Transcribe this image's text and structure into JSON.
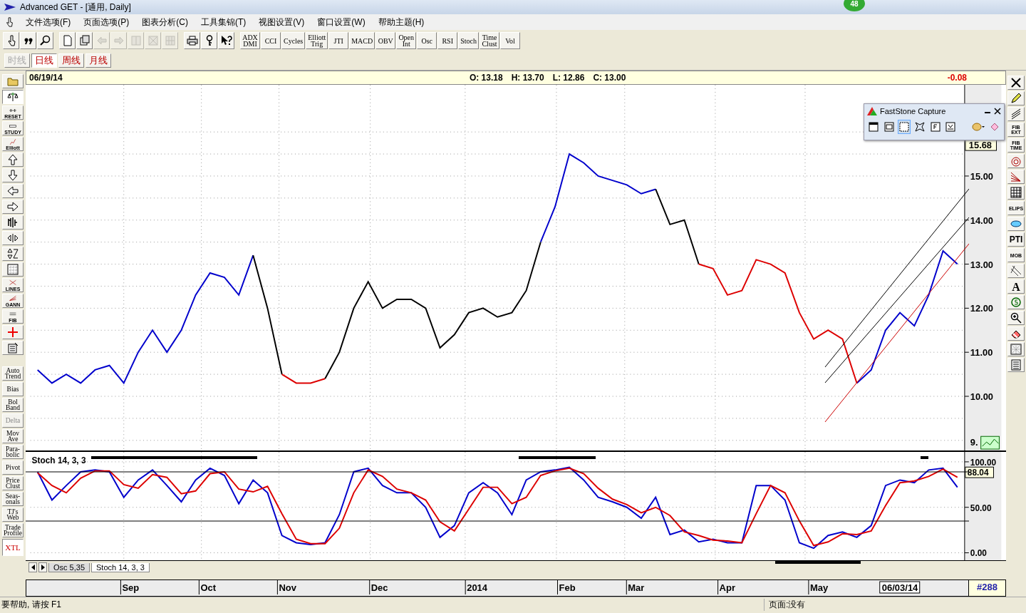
{
  "window": {
    "title": "Advanced GET - [通用, Daily]",
    "badge": "48"
  },
  "menu": [
    "文件选项(F)",
    "页面选项(P)",
    "图表分析(C)",
    "工具集锦(T)",
    "视图设置(V)",
    "窗口设置(W)",
    "帮助主题(H)"
  ],
  "toolbar": {
    "icon_buttons": [
      {
        "disabled": false
      },
      {
        "disabled": false
      },
      {
        "disabled": false
      },
      {
        "disabled": false
      },
      {
        "disabled": false
      },
      {
        "disabled": true
      },
      {
        "disabled": true
      },
      {
        "disabled": true
      },
      {
        "disabled": true
      },
      {
        "disabled": true
      },
      {
        "disabled": false
      },
      {
        "disabled": false
      },
      {
        "disabled": false
      }
    ],
    "study_buttons": [
      "ADX\nDMI",
      "CCI",
      "Cycles",
      "Elliott\nTrig",
      "JTI",
      "MACD",
      "OBV",
      "Open\nInt",
      "Osc",
      "RSI",
      "Stoch",
      "Time\nClust",
      "Vol"
    ]
  },
  "timeframes": [
    {
      "label": "时线",
      "selected": false,
      "disabled": true
    },
    {
      "label": "日线",
      "selected": true,
      "disabled": false
    },
    {
      "label": "周线",
      "selected": false,
      "disabled": false
    },
    {
      "label": "月线",
      "selected": false,
      "disabled": false
    }
  ],
  "left_toolbar": {
    "tools": [
      {
        "kind": "icon",
        "selected": false
      },
      {
        "kind": "icon",
        "selected": true
      },
      {
        "kind": "labeled",
        "label": "RESET",
        "selected": false
      },
      {
        "kind": "labeled",
        "label": "STUDY",
        "selected": false
      },
      {
        "kind": "labeled",
        "label": "Elliott",
        "selected": false
      },
      {
        "kind": "icon",
        "selected": false
      },
      {
        "kind": "icon",
        "selected": false
      },
      {
        "kind": "icon",
        "selected": false
      },
      {
        "kind": "icon",
        "selected": false
      },
      {
        "kind": "icon",
        "selected": false
      },
      {
        "kind": "icon",
        "selected": false
      },
      {
        "kind": "icon",
        "selected": false
      },
      {
        "kind": "icon",
        "selected": false
      },
      {
        "kind": "labeled",
        "label": "LINES",
        "selected": false
      },
      {
        "kind": "labeled",
        "label": "GANN",
        "selected": false
      },
      {
        "kind": "labeled",
        "label": "FIB",
        "selected": false
      },
      {
        "kind": "icon",
        "selected": false
      },
      {
        "kind": "icon",
        "selected": false
      }
    ],
    "studies": [
      {
        "label": "Auto\nTrend",
        "disabled": false,
        "selected": false
      },
      {
        "label": "Bias",
        "disabled": false,
        "selected": false
      },
      {
        "label": "Bol\nBand",
        "disabled": false,
        "selected": false
      },
      {
        "label": "Delta",
        "disabled": true,
        "selected": false
      },
      {
        "label": "Mov\nAve",
        "disabled": false,
        "selected": false
      },
      {
        "label": "Para-\nbolic",
        "disabled": false,
        "selected": false
      },
      {
        "label": "Pivot",
        "disabled": false,
        "selected": false
      },
      {
        "label": "Price\nClust",
        "disabled": false,
        "selected": false
      },
      {
        "label": "Seas-\nonals",
        "disabled": false,
        "selected": false
      },
      {
        "label": "TJ's\nWeb",
        "disabled": false,
        "selected": false
      },
      {
        "label": "Trade\nProfile",
        "disabled": false,
        "selected": false
      },
      {
        "label": "XTL",
        "disabled": false,
        "selected": true
      }
    ]
  },
  "right_toolbar": [
    {
      "kind": "icon"
    },
    {
      "kind": "icon"
    },
    {
      "kind": "icon"
    },
    {
      "kind": "labeled",
      "label": "FIB\nEXT"
    },
    {
      "kind": "labeled",
      "label": "FIB\nTIME"
    },
    {
      "kind": "icon"
    },
    {
      "kind": "icon"
    },
    {
      "kind": "icon"
    },
    {
      "kind": "labeled",
      "label": "ELIPS"
    },
    {
      "kind": "icon"
    },
    {
      "kind": "text",
      "label": "PTI"
    },
    {
      "kind": "labeled",
      "label": "MOB"
    },
    {
      "kind": "icon"
    },
    {
      "kind": "text",
      "label": "A"
    },
    {
      "kind": "icon"
    },
    {
      "kind": "icon"
    },
    {
      "kind": "icon"
    },
    {
      "kind": "icon"
    },
    {
      "kind": "icon"
    }
  ],
  "quote_header": {
    "date": "06/19/14",
    "open": "O: 13.18",
    "high": "H: 13.70",
    "low": "L: 12.86",
    "close": "C: 13.00",
    "change": "-0.08"
  },
  "price_chart": {
    "last_price": "15.68",
    "cut_label": "9.",
    "chart_data": {
      "type": "line",
      "grid": true,
      "ylim": [
        8.77,
        17.07
      ],
      "yticks": [
        {
          "value": 10,
          "label": "10.00"
        },
        {
          "value": 11,
          "label": "11.00"
        },
        {
          "value": 12,
          "label": "12.00"
        },
        {
          "value": 13,
          "label": "13.00"
        },
        {
          "value": 14,
          "label": "14.00"
        },
        {
          "value": 15,
          "label": "15.00"
        }
      ],
      "series": [
        {
          "color": "#0000cc",
          "values": [
            10.6,
            10.3,
            10.5,
            10.3,
            10.6,
            10.7,
            10.3,
            11.0,
            11.5,
            11.0,
            11.5,
            12.3,
            12.8,
            12.7,
            12.3,
            13.2,
            null,
            null,
            null,
            null,
            null,
            null,
            null,
            null,
            null,
            null,
            null,
            null,
            null,
            null,
            null,
            null,
            null,
            null,
            null,
            13.5,
            14.3,
            15.5,
            15.3,
            15.0,
            14.9,
            14.8,
            14.6,
            14.7,
            null,
            null,
            null,
            null,
            null,
            null,
            null,
            null,
            null,
            null,
            null,
            null,
            null,
            10.3,
            10.6,
            11.5,
            11.9,
            11.6,
            12.3,
            13.3,
            13.0
          ]
        },
        {
          "color": "#000000",
          "values": [
            null,
            null,
            null,
            null,
            null,
            null,
            null,
            null,
            null,
            null,
            null,
            null,
            null,
            null,
            null,
            13.2,
            12.0,
            10.5,
            null,
            null,
            10.4,
            11.0,
            12.0,
            12.6,
            12.0,
            12.2,
            12.2,
            12.0,
            11.1,
            11.4,
            11.9,
            12.0,
            11.8,
            11.9,
            12.4,
            13.5,
            null,
            null,
            null,
            null,
            null,
            null,
            null,
            14.7,
            13.9,
            14.0,
            13.0,
            null,
            null,
            null,
            null,
            null,
            null,
            null,
            null,
            null,
            null,
            null,
            null,
            null,
            null,
            null,
            null,
            null,
            null
          ]
        },
        {
          "color": "#dd0000",
          "values": [
            null,
            null,
            null,
            null,
            null,
            null,
            null,
            null,
            null,
            null,
            null,
            null,
            null,
            null,
            null,
            null,
            null,
            10.5,
            10.3,
            10.3,
            10.4,
            null,
            null,
            null,
            null,
            null,
            null,
            null,
            null,
            null,
            null,
            null,
            null,
            null,
            null,
            null,
            null,
            null,
            null,
            null,
            null,
            null,
            null,
            null,
            null,
            null,
            13.0,
            12.9,
            12.3,
            12.4,
            13.1,
            13.0,
            12.8,
            11.9,
            11.3,
            11.5,
            11.3,
            10.3,
            null,
            null,
            null,
            null,
            null,
            null,
            null
          ]
        }
      ]
    }
  },
  "stoch_chart": {
    "current_value": "88.04",
    "chart_data": {
      "type": "line",
      "title": "Stoch 14, 3, 3",
      "grid": true,
      "ylim": [
        -8.6,
        110.9
      ],
      "yticks": [
        {
          "value": 0,
          "label": "0.00"
        },
        {
          "value": 50,
          "label": "50.00"
        },
        {
          "value": 100,
          "label": "100.00"
        }
      ],
      "series": [
        {
          "color": "#0000cc",
          "values": [
            89,
            58,
            74,
            89,
            91,
            89,
            61,
            80,
            91,
            74,
            56,
            80,
            93,
            85,
            54,
            80,
            66,
            19,
            11,
            9,
            11,
            42,
            89,
            93,
            74,
            66,
            66,
            50,
            17,
            30,
            66,
            77,
            66,
            42,
            80,
            89,
            91,
            94,
            80,
            61,
            56,
            50,
            38,
            61,
            20,
            25,
            12,
            15,
            11,
            11,
            74,
            74,
            58,
            11,
            5,
            19,
            23,
            17,
            30,
            74,
            80,
            77,
            91,
            93,
            72
          ]
        },
        {
          "color": "#dd0000",
          "values": [
            88,
            74,
            66,
            82,
            90,
            90,
            75,
            71,
            86,
            83,
            65,
            68,
            87,
            89,
            70,
            67,
            73,
            43,
            15,
            10,
            10,
            27,
            66,
            91,
            84,
            70,
            66,
            58,
            34,
            24,
            48,
            72,
            72,
            54,
            61,
            85,
            90,
            93,
            87,
            71,
            59,
            53,
            44,
            50,
            41,
            23,
            19,
            14,
            13,
            11,
            43,
            74,
            66,
            35,
            8,
            12,
            21,
            20,
            24,
            52,
            77,
            79,
            84,
            92,
            83
          ]
        }
      ]
    }
  },
  "pane_tabs": [
    {
      "label": "Osc 5,35",
      "selected": false
    },
    {
      "label": "Stoch 14, 3, 3",
      "selected": true
    }
  ],
  "time_axis": {
    "months": [
      "Sep",
      "Oct",
      "Nov",
      "Dec",
      "2014",
      "Feb",
      "Mar",
      "Apr",
      "May"
    ],
    "cursor_date": "06/03/14",
    "bar_count": "#288"
  },
  "capture_window": {
    "title": "FastStone Capture"
  },
  "status_bar": {
    "help": "要帮助, 请按 F1",
    "page": "页面:没有"
  }
}
